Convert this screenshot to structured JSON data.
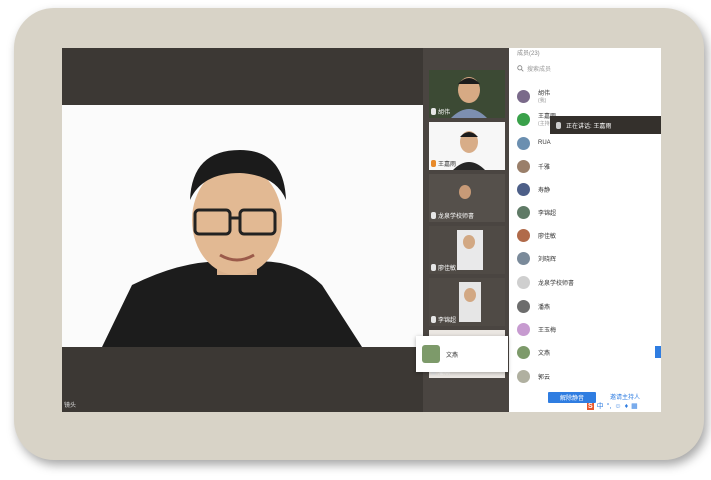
{
  "main_view": {
    "corner_label": "镜头"
  },
  "participants_strip": [
    {
      "name": "胡伟"
    },
    {
      "name": "王嘉雨"
    },
    {
      "name": "龙泉学校师書"
    },
    {
      "name": "廖佳敏"
    },
    {
      "name": "李锦超"
    },
    {
      "name": "潘燕"
    }
  ],
  "popup": {
    "name": "文燕"
  },
  "speaking": {
    "text": "正在讲话: 王嘉雨"
  },
  "panel": {
    "title": "成员(23)",
    "search_placeholder": "搜索成员",
    "members": [
      {
        "name": "胡伟",
        "sub": "(我)",
        "color": "#7a6a8a"
      },
      {
        "name": "王嘉雨",
        "sub": "(主持人)",
        "color": "#3aa14a"
      },
      {
        "name": "RUA",
        "sub": "",
        "color": "#6b8fb0"
      },
      {
        "name": "千雅",
        "sub": "",
        "color": "#9a7f6a"
      },
      {
        "name": "寿静",
        "sub": "",
        "color": "#4d5f88"
      },
      {
        "name": "李锦超",
        "sub": "",
        "color": "#5f7a66"
      },
      {
        "name": "廖佳敏",
        "sub": "",
        "color": "#b06a4a"
      },
      {
        "name": "刘晓辉",
        "sub": "",
        "color": "#7a8a9a"
      },
      {
        "name": "龙泉学校师書",
        "sub": "",
        "color": "#cfcfcf"
      },
      {
        "name": "潘燕",
        "sub": "",
        "color": "#6d6d6d"
      },
      {
        "name": "王玉梅",
        "sub": "",
        "color": "#c79bd0"
      },
      {
        "name": "文燕",
        "sub": "",
        "color": "#7d9a6a"
      },
      {
        "name": "郭云",
        "sub": "",
        "color": "#b0b0a0"
      }
    ],
    "unmute_all_label": "解除静音",
    "more_label": "邀请主持人"
  },
  "ime": {
    "badge": "S",
    "items": [
      "中",
      "°,",
      "☺",
      "♦",
      "▦"
    ]
  }
}
